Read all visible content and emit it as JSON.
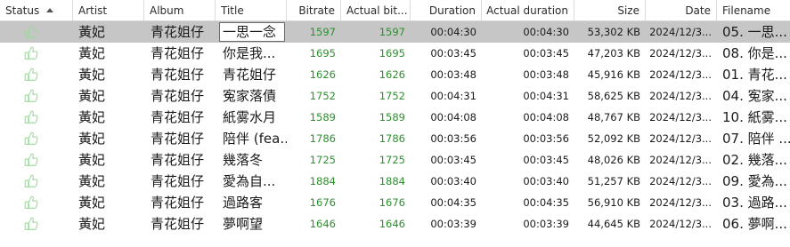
{
  "columns": {
    "status": "Status",
    "artist": "Artist",
    "album": "Album",
    "title": "Title",
    "bitrate": "Bitrate",
    "actual_bitrate": "Actual bit...",
    "duration": "Duration",
    "actual_duration": "Actual duration",
    "size": "Size",
    "date": "Date",
    "filename": "Filename"
  },
  "status_icon": "thumbs-up-icon",
  "colors": {
    "selected_row": "#c6c6c6",
    "bitrate_text": "#2f8f2f",
    "status_icon": "#9fd89f"
  },
  "rows": [
    {
      "artist": "黃妃",
      "album": "青花姐仔",
      "title": "一思一念",
      "bitrate": "1597",
      "actual_bitrate": "1597",
      "duration": "00:04:30",
      "actual_duration": "00:04:30",
      "size": "53,302 KB",
      "date": "2024/12/3...",
      "filename": "05. 一思..."
    },
    {
      "artist": "黃妃",
      "album": "青花姐仔",
      "title": "你是我...",
      "bitrate": "1695",
      "actual_bitrate": "1695",
      "duration": "00:03:45",
      "actual_duration": "00:03:45",
      "size": "47,203 KB",
      "date": "2024/12/3...",
      "filename": "08. 你是..."
    },
    {
      "artist": "黃妃",
      "album": "青花姐仔",
      "title": "青花姐仔",
      "bitrate": "1626",
      "actual_bitrate": "1626",
      "duration": "00:03:48",
      "actual_duration": "00:03:48",
      "size": "45,916 KB",
      "date": "2024/12/3...",
      "filename": "01. 青花..."
    },
    {
      "artist": "黃妃",
      "album": "青花姐仔",
      "title": "寃家落債",
      "bitrate": "1752",
      "actual_bitrate": "1752",
      "duration": "00:04:31",
      "actual_duration": "00:04:31",
      "size": "58,625 KB",
      "date": "2024/12/3...",
      "filename": "04. 寃家..."
    },
    {
      "artist": "黃妃",
      "album": "青花姐仔",
      "title": "紙雾水月",
      "bitrate": "1589",
      "actual_bitrate": "1589",
      "duration": "00:04:08",
      "actual_duration": "00:04:08",
      "size": "48,767 KB",
      "date": "2024/12/3...",
      "filename": "10. 紙雾..."
    },
    {
      "artist": "黃妃",
      "album": "青花姐仔",
      "title": "陪伴 (fea...",
      "bitrate": "1786",
      "actual_bitrate": "1786",
      "duration": "00:03:56",
      "actual_duration": "00:03:56",
      "size": "52,092 KB",
      "date": "2024/12/3...",
      "filename": "07. 陪伴 ..."
    },
    {
      "artist": "黃妃",
      "album": "青花姐仔",
      "title": "幾落冬",
      "bitrate": "1725",
      "actual_bitrate": "1725",
      "duration": "00:03:45",
      "actual_duration": "00:03:45",
      "size": "48,026 KB",
      "date": "2024/12/3...",
      "filename": "02. 幾落..."
    },
    {
      "artist": "黃妃",
      "album": "青花姐仔",
      "title": "愛為自...",
      "bitrate": "1884",
      "actual_bitrate": "1884",
      "duration": "00:03:40",
      "actual_duration": "00:03:40",
      "size": "51,257 KB",
      "date": "2024/12/3...",
      "filename": "09. 愛為..."
    },
    {
      "artist": "黃妃",
      "album": "青花姐仔",
      "title": "過路客",
      "bitrate": "1676",
      "actual_bitrate": "1676",
      "duration": "00:04:35",
      "actual_duration": "00:04:35",
      "size": "56,910 KB",
      "date": "2024/12/3...",
      "filename": "03. 過路..."
    },
    {
      "artist": "黃妃",
      "album": "青花姐仔",
      "title": "夢啊望",
      "bitrate": "1646",
      "actual_bitrate": "1646",
      "duration": "00:03:39",
      "actual_duration": "00:03:39",
      "size": "44,645 KB",
      "date": "2024/12/3...",
      "filename": "06. 夢啊..."
    }
  ]
}
